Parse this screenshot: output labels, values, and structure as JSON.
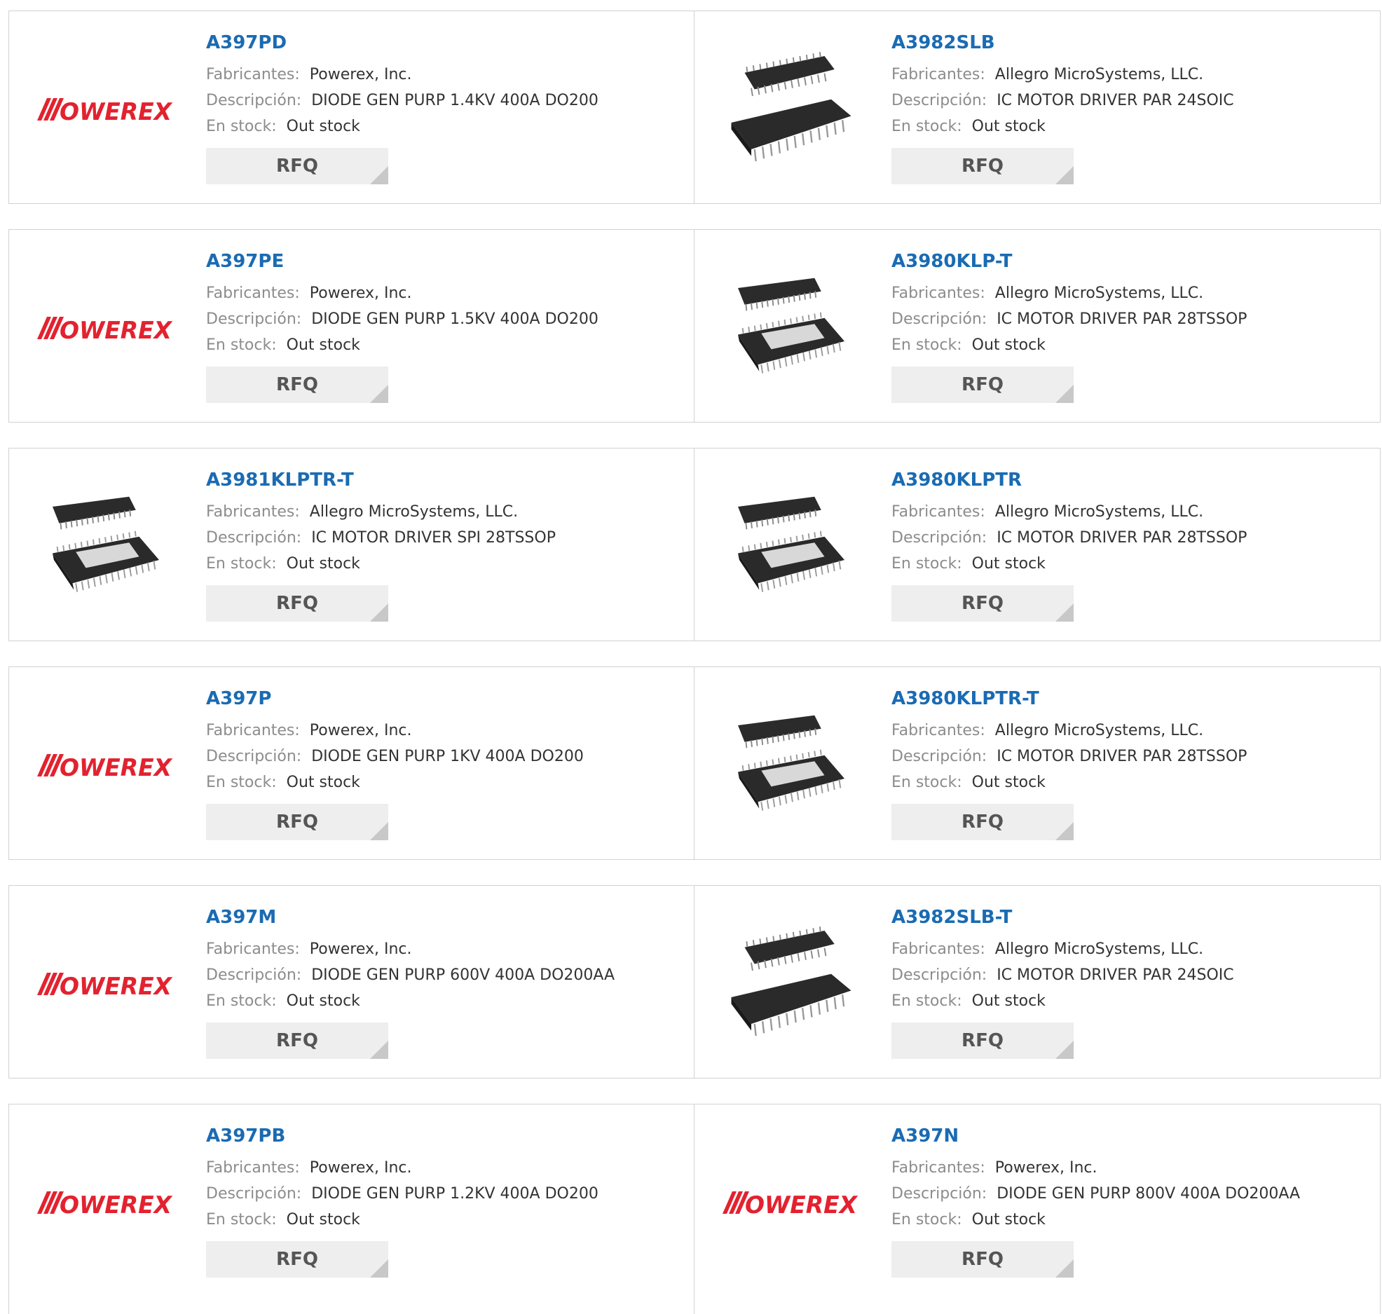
{
  "labels": {
    "manufacturer": "Fabricantes:",
    "description": "Descripción:",
    "stock": "En stock:",
    "rfq": "RFQ"
  },
  "logo_text": "POWEREX",
  "colors": {
    "part_link": "#1a6bb3",
    "powerex_red": "#e3222f",
    "label_gray": "#8c8c8c",
    "button_bg": "#eeeeee",
    "border": "#d2d2d2"
  },
  "products": [
    {
      "part": "A397PD",
      "manufacturer": "Powerex, Inc.",
      "description": "DIODE GEN PURP 1.4KV 400A DO200",
      "stock": "Out stock",
      "image": "powerex-logo"
    },
    {
      "part": "A3982SLB",
      "manufacturer": "Allegro MicroSystems, LLC.",
      "description": "IC MOTOR DRIVER PAR 24SOIC",
      "stock": "Out stock",
      "image": "soic-chip"
    },
    {
      "part": "A397PE",
      "manufacturer": "Powerex, Inc.",
      "description": "DIODE GEN PURP 1.5KV 400A DO200",
      "stock": "Out stock",
      "image": "powerex-logo"
    },
    {
      "part": "A3980KLP-T",
      "manufacturer": "Allegro MicroSystems, LLC.",
      "description": "IC MOTOR DRIVER PAR 28TSSOP",
      "stock": "Out stock",
      "image": "tssop-chip"
    },
    {
      "part": "A3981KLPTR-T",
      "manufacturer": "Allegro MicroSystems, LLC.",
      "description": "IC MOTOR DRIVER SPI 28TSSOP",
      "stock": "Out stock",
      "image": "tssop-chip"
    },
    {
      "part": "A3980KLPTR",
      "manufacturer": "Allegro MicroSystems, LLC.",
      "description": "IC MOTOR DRIVER PAR 28TSSOP",
      "stock": "Out stock",
      "image": "tssop-chip"
    },
    {
      "part": "A397P",
      "manufacturer": "Powerex, Inc.",
      "description": "DIODE GEN PURP 1KV 400A DO200",
      "stock": "Out stock",
      "image": "powerex-logo"
    },
    {
      "part": "A3980KLPTR-T",
      "manufacturer": "Allegro MicroSystems, LLC.",
      "description": "IC MOTOR DRIVER PAR 28TSSOP",
      "stock": "Out stock",
      "image": "tssop-chip"
    },
    {
      "part": "A397M",
      "manufacturer": "Powerex, Inc.",
      "description": "DIODE GEN PURP 600V 400A DO200AA",
      "stock": "Out stock",
      "image": "powerex-logo"
    },
    {
      "part": "A3982SLB-T",
      "manufacturer": "Allegro MicroSystems, LLC.",
      "description": "IC MOTOR DRIVER PAR 24SOIC",
      "stock": "Out stock",
      "image": "soic-chip"
    },
    {
      "part": "A397PB",
      "manufacturer": "Powerex, Inc.",
      "description": "DIODE GEN PURP 1.2KV 400A DO200",
      "stock": "Out stock",
      "image": "powerex-logo"
    },
    {
      "part": "A397N",
      "manufacturer": "Powerex, Inc.",
      "description": "DIODE GEN PURP 800V 400A DO200AA",
      "stock": "Out stock",
      "image": "powerex-logo"
    }
  ]
}
